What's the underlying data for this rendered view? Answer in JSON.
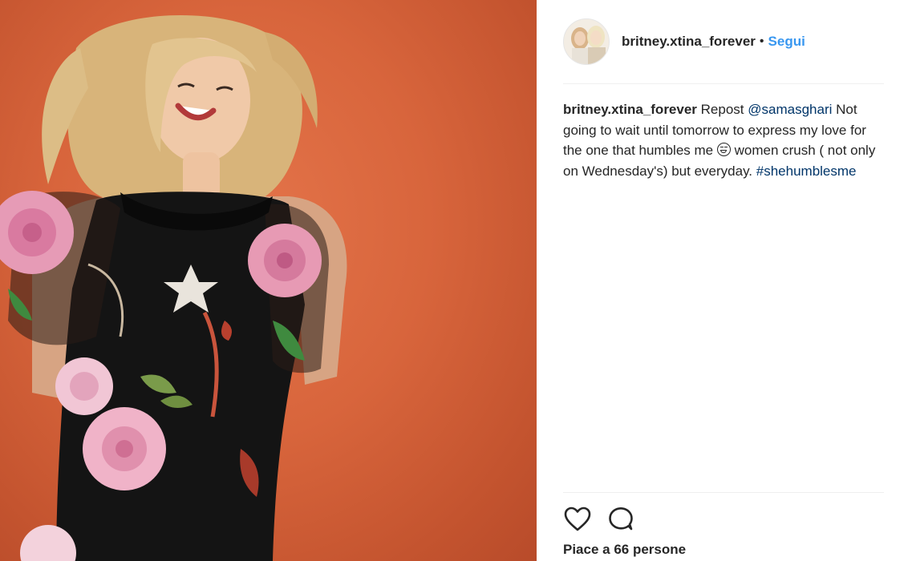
{
  "post": {
    "username": "britney.xtina_forever",
    "separator": "•",
    "follow_label": "Segui"
  },
  "caption": {
    "username": "britney.xtina_forever",
    "repost_word": "Repost",
    "mention": "@samasghari",
    "text_part1": "Not going to wait until tomorrow to express my love for the one that humbles me",
    "emoji": "grinning-squinting-face",
    "text_part2": "women crush ( not only on Wednesday's) but everyday.",
    "hashtag": "#shehumblesme"
  },
  "actions": {
    "like_icon": "heart-outline-icon",
    "comment_icon": "comment-bubble-icon"
  },
  "likes": {
    "text": "Piace a 66 persone"
  },
  "colors": {
    "background_photo": "#d8653c",
    "link": "#3897f0",
    "mention_link": "#003569",
    "text": "#262626",
    "divider": "#efefef"
  }
}
